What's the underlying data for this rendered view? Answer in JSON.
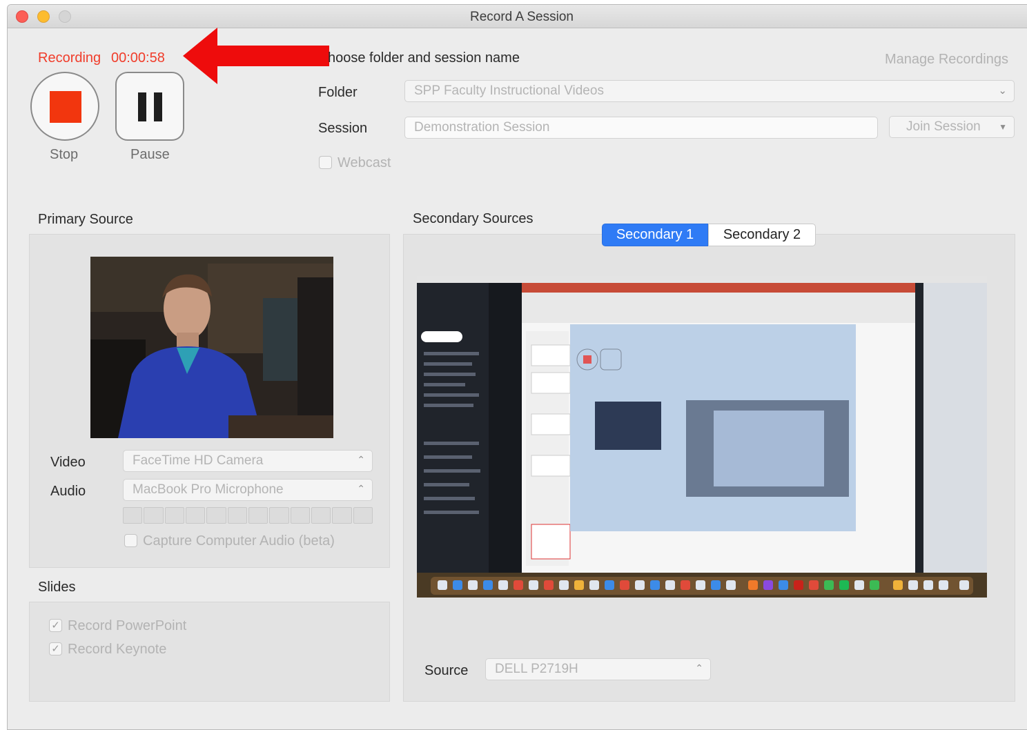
{
  "window": {
    "title": "Record A Session"
  },
  "recording": {
    "status_label": "Recording",
    "elapsed": "00:00:58",
    "stop_label": "Stop",
    "pause_label": "Pause"
  },
  "session_form": {
    "heading": "hoose folder and session name",
    "manage_link": "Manage Recordings",
    "folder_label": "Folder",
    "folder_value": "SPP Faculty Instructional Videos",
    "session_label": "Session",
    "session_value": "Demonstration Session",
    "join_label": "Join Session",
    "webcast_label": "Webcast"
  },
  "primary": {
    "heading": "Primary Source",
    "video_label": "Video",
    "video_value": "FaceTime HD Camera",
    "audio_label": "Audio",
    "audio_value": "MacBook Pro Microphone",
    "capture_label": "Capture Computer Audio (beta)"
  },
  "slides": {
    "heading": "Slides",
    "ppt_label": "Record PowerPoint",
    "keynote_label": "Record Keynote"
  },
  "secondary": {
    "heading": "Secondary Sources",
    "tabs": [
      "Secondary 1",
      "Secondary 2"
    ],
    "source_label": "Source",
    "source_value": "DELL P2719H"
  },
  "colors": {
    "accent": "#2f7bf5",
    "recording": "#f03c2a",
    "stop_square": "#f2360e"
  }
}
